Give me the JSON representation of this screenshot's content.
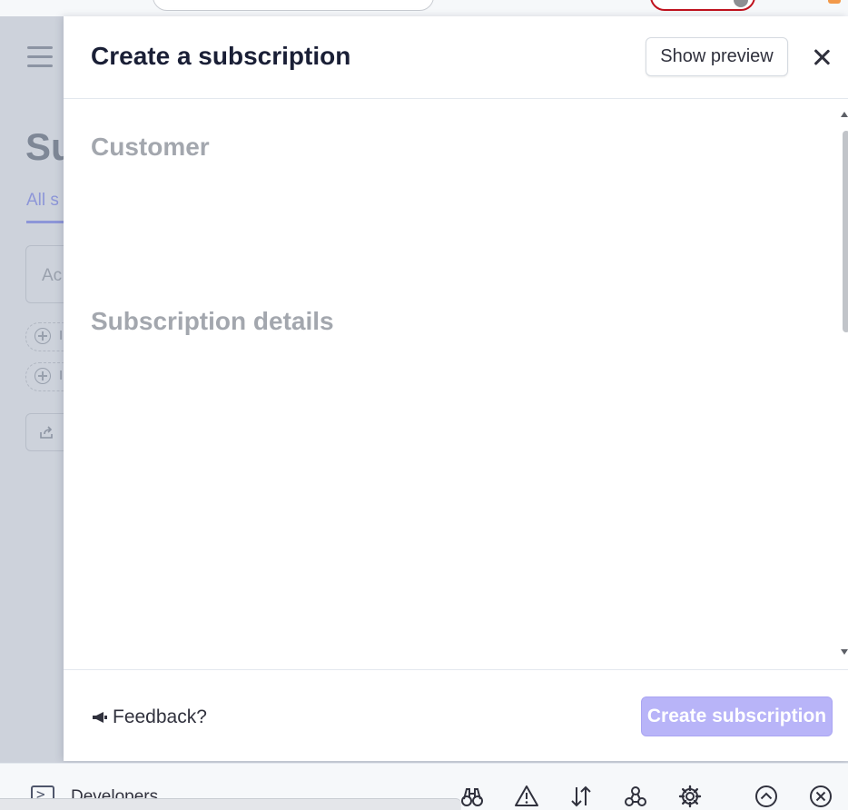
{
  "background_page": {
    "title_partial": "Su",
    "tab_partial": "All s",
    "search_partial": "Ac",
    "filter_labels": [
      "I",
      "I"
    ]
  },
  "modal": {
    "title": "Create a subscription",
    "show_preview_label": "Show preview",
    "sections": {
      "customer": "Customer",
      "subscription_details": "Subscription details"
    },
    "footer": {
      "feedback_label": "Feedback?",
      "create_label": "Create subscription"
    }
  },
  "bottom_bar": {
    "developers_label": "Developers",
    "icons": [
      "binoculars-icon",
      "warning-icon",
      "sort-arrows-icon",
      "webhooks-icon",
      "settings-gear-icon",
      "chevron-up-circle-icon",
      "close-circle-icon"
    ]
  },
  "colors": {
    "accent_disabled": "#b8b4f8",
    "heading_muted": "#a3a7ae",
    "overlay": "#cdd2db",
    "text_primary": "#1a1f36"
  }
}
